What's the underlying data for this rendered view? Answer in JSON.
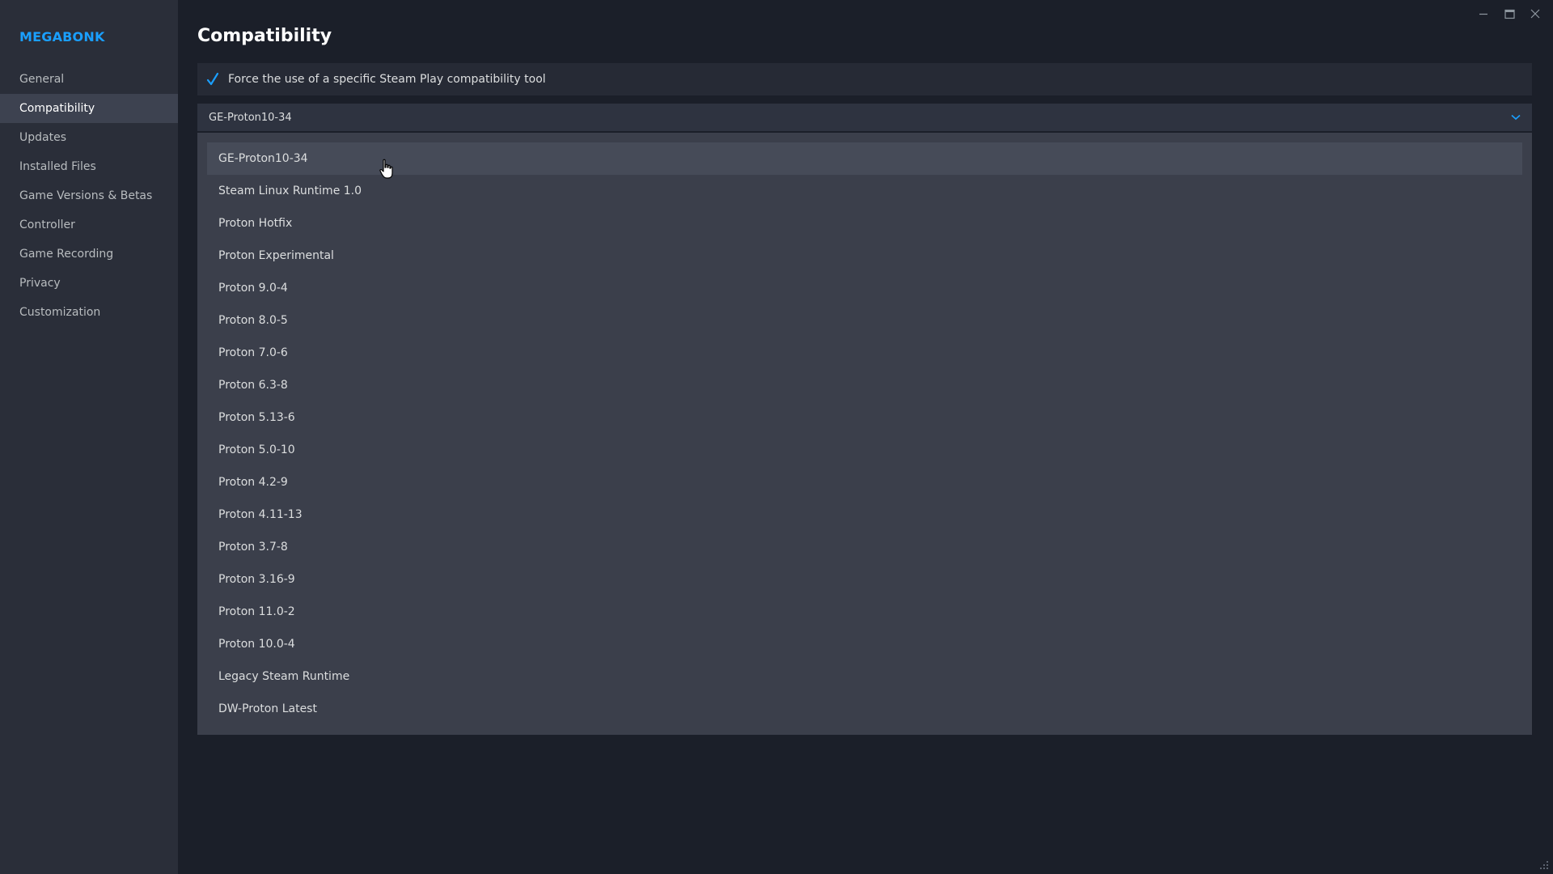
{
  "app": {
    "name": "MEGABONK",
    "accent_color": "#1a9fff"
  },
  "sidebar": {
    "items": [
      {
        "label": "General",
        "active": false
      },
      {
        "label": "Compatibility",
        "active": true
      },
      {
        "label": "Updates",
        "active": false
      },
      {
        "label": "Installed Files",
        "active": false
      },
      {
        "label": "Game Versions & Betas",
        "active": false
      },
      {
        "label": "Controller",
        "active": false
      },
      {
        "label": "Game Recording",
        "active": false
      },
      {
        "label": "Privacy",
        "active": false
      },
      {
        "label": "Customization",
        "active": false
      }
    ]
  },
  "window_controls": {
    "icons": [
      "minimize-icon",
      "maximize-icon",
      "close-icon"
    ]
  },
  "main": {
    "title": "Compatibility",
    "force_tool": {
      "label": "Force the use of a specific Steam Play compatibility tool",
      "checked": true
    },
    "dropdown": {
      "selected": "GE-Proton10-34",
      "expanded": true,
      "hovered_option": "GE-Proton10-34",
      "options": [
        "GE-Proton10-34",
        "Steam Linux Runtime 1.0",
        "Proton Hotfix",
        "Proton Experimental",
        "Proton 9.0-4",
        "Proton 8.0-5",
        "Proton 7.0-6",
        "Proton 6.3-8",
        "Proton 5.13-6",
        "Proton 5.0-10",
        "Proton 4.2-9",
        "Proton 4.11-13",
        "Proton 3.7-8",
        "Proton 3.16-9",
        "Proton 11.0-2",
        "Proton 10.0-4",
        "Legacy Steam Runtime",
        "DW-Proton Latest"
      ]
    }
  }
}
